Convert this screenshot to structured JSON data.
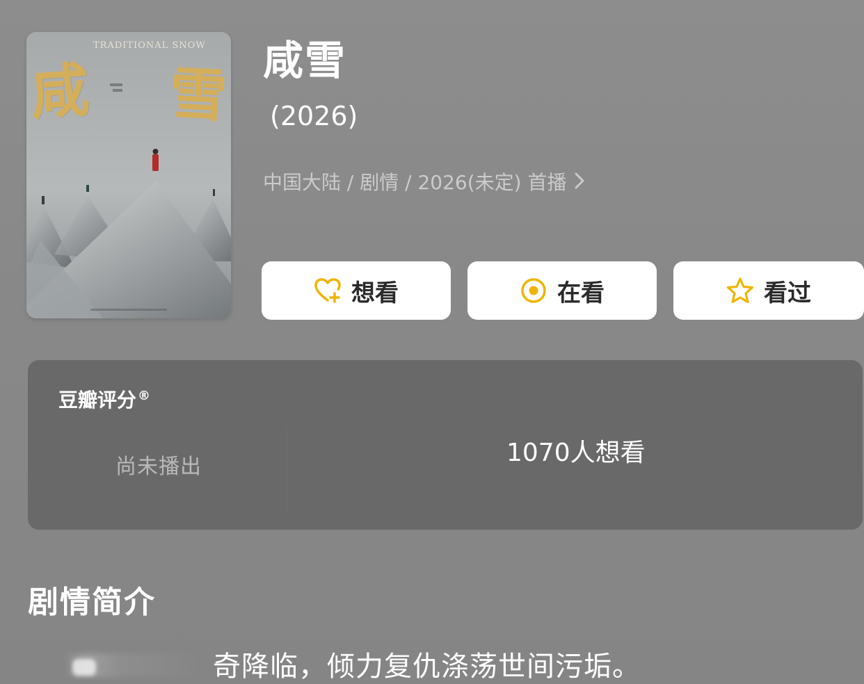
{
  "poster": {
    "title_left": "咸",
    "title_right": "雪",
    "english_title": "TRADITIONAL SNOW"
  },
  "show": {
    "title": "咸雪",
    "year": "(2026)",
    "meta": "中国大陆 / 剧情 / 2026(未定) 首播",
    "meta_chevron": "chevron-right-icon"
  },
  "actions": {
    "want_label": "想看",
    "watching_label": "在看",
    "watched_label": "看过",
    "want_icon": "heart-plus-icon",
    "watching_icon": "target-circle-icon",
    "watched_icon": "star-icon",
    "icon_color": "#f0b400"
  },
  "rating": {
    "title": "豆瓣评分",
    "registered_mark": "®",
    "status": "尚未播出",
    "want_count": "1070人想看"
  },
  "synopsis": {
    "heading": "剧情简介",
    "text": "奇降临，倾力复仇涤荡世间污垢。"
  }
}
